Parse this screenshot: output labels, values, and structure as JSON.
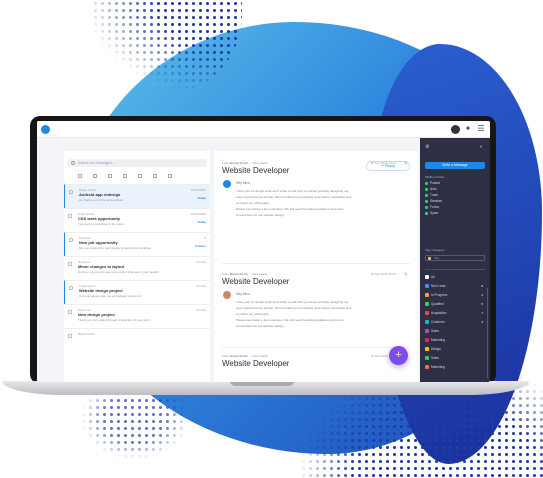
{
  "reply_label": "Reply",
  "search_placeholder": "Search for messages...",
  "new_message_label": "Write a Message",
  "messages": [
    {
      "tag": "Brand Smith",
      "subject": "Android app redesign",
      "preview": "Hi, thank you for the screenshots.",
      "time": "10/09/2020",
      "label": "Today"
    },
    {
      "tag": "Emily Carter",
      "subject": "CSS work opportunity",
      "preview": "You want to contribute to the work...",
      "time": "10/09/2020",
      "label": "Today"
    },
    {
      "tag": "Rosanne",
      "subject": "New job opportunity",
      "preview": "Are you looking for new design projects then complete",
      "time": "5",
      "label": "2 hours"
    },
    {
      "tag": "Rosanne",
      "subject": "Minor changes to layout",
      "preview": "Hi there, as you can see some minor changes to your design",
      "time": "2 hours",
      "label": ""
    },
    {
      "tag": "Linda Green",
      "subject": "Website design project",
      "preview": "Can you please give me an updated version of",
      "time": "3 hours",
      "label": ""
    },
    {
      "tag": "Peter Lee",
      "subject": "New design project",
      "preview": "Thank you for posting through interaction of your work",
      "time": "3 hours",
      "label": ""
    },
    {
      "tag": "Brand Smith",
      "subject": "",
      "preview": "",
      "time": "",
      "label": ""
    }
  ],
  "thread": [
    {
      "from_prefix": "From",
      "from_name": "Brand Smith",
      "to_name": "New Leads",
      "title": "Website Developer",
      "date": "10 Sep 2020 10:22",
      "sender": "Hey Nico,",
      "body": [
        "I love your UI design work and I'd like to talk with you about possibly designing our",
        "new cryptocurrency startup. We're looking for something clean with a minimalist look",
        "to reflect our philosophy.",
        "Please see below a few examples. We will need branding guidelines and some",
        "screenshots for our website design."
      ]
    },
    {
      "from_prefix": "From",
      "from_name": "Brand Smith",
      "to_name": "New Leads",
      "title": "Website Developer",
      "date": "10 Sep 2020 10:22",
      "sender": "Hey Nico,",
      "body": [
        "I love your UI design work and I'd like to talk with you about possibly designing our",
        "new cryptocurrency startup. We're looking for something clean with a minimalist look",
        "to reflect our philosophy.",
        "Please see below a few examples. We will need branding guidelines and some",
        "screenshots for our website design."
      ]
    },
    {
      "from_prefix": "From",
      "from_name": "Brand Smith",
      "to_name": "New Leads",
      "title": "Website Developer",
      "date": "10 Sep 2020 10:22"
    }
  ],
  "mailboxes_title": "Mailbox Folder",
  "mailboxes": [
    "Posted",
    "Auto",
    "Trash",
    "Standart",
    "Forms",
    "Spam"
  ],
  "tags_title": "Tag / Category",
  "tag_selected": "Tag",
  "labels": [
    {
      "name": "All",
      "color": "#ffffff",
      "count": ""
    },
    {
      "name": "New Lead",
      "color": "#3f8cff",
      "count": "8"
    },
    {
      "name": "In Progress",
      "color": "#f5a623",
      "count": "2"
    },
    {
      "name": "Qualified",
      "color": "#2ecc71",
      "count": "5"
    },
    {
      "name": "Acquisition",
      "color": "#e74c3c",
      "count": "7"
    },
    {
      "name": "Customer",
      "color": "#00bcd4",
      "count": "3"
    },
    {
      "name": "Sales",
      "color": "#9b59b6",
      "count": ""
    },
    {
      "name": "Marketing",
      "color": "#e91e63",
      "count": ""
    },
    {
      "name": "Design",
      "color": "#ffc107",
      "count": ""
    },
    {
      "name": "Sales",
      "color": "#2ecc71",
      "count": ""
    },
    {
      "name": "Marketing",
      "color": "#ff7043",
      "count": ""
    }
  ],
  "fab_label": "+"
}
